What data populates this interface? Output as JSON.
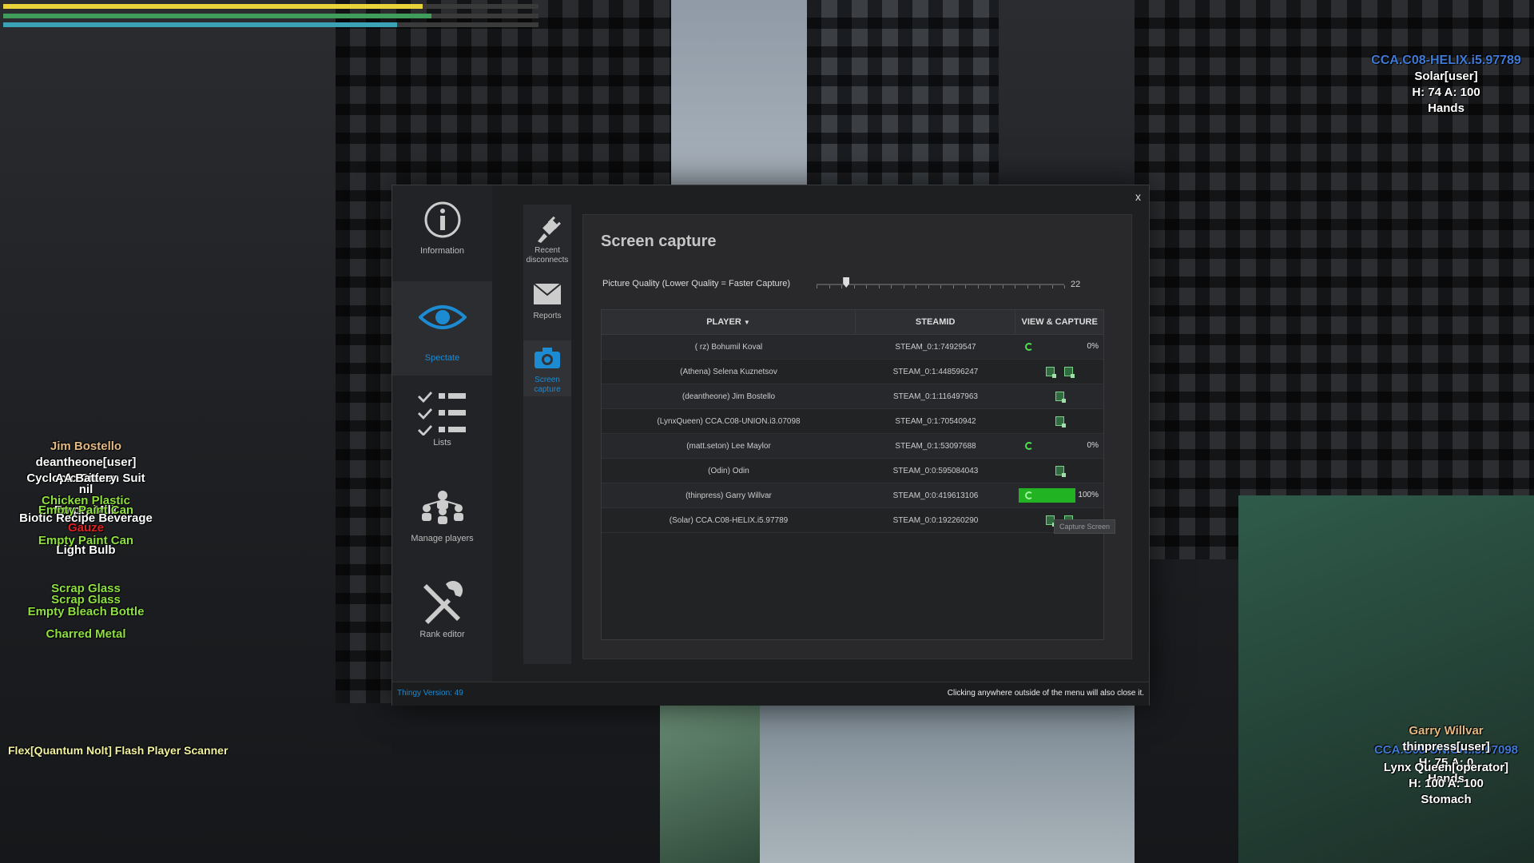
{
  "hud": {
    "health_fraction": 0.98,
    "armor_fraction": 1.0,
    "stamina_fraction": 0.92,
    "colors": {
      "health": "#e8d43a",
      "armor": "#3f9c5a",
      "stamina": "#3aa3b5"
    }
  },
  "world_labels": {
    "left": [
      "Jim Bostello",
      "deantheone[user]",
      "Cyclopic Citizen Suit",
      "AA Battery",
      "nil",
      "Chicken Plastic",
      "Empty Milk",
      "Empty Paint Can",
      "Biotic Recipe Beverage",
      "Gauze",
      "Empty Paint Can",
      "Light Bulb",
      "Scrap Glass",
      "Scrap Glass",
      "Empty Bleach Bottle",
      "Charred Metal"
    ],
    "left_bottom": "Flex[Quantum Nolt] Flash Player Scanner",
    "top_right": {
      "name": "CCA.C08-HELIX.i5.97789",
      "user": "Solar[user]",
      "stats": "H: 74 A: 100",
      "weapon": "Hands"
    },
    "bottom_right": {
      "name": "Garry Willvar",
      "tag": "CCA.C08-UNION.i3.07098",
      "role": "thinpress[user]",
      "stats": "H: 75 A: 0",
      "user2": "Lynx Queen[operator]",
      "weapon": "Hands",
      "stats2": "H: 100 A: 100",
      "item": "Stomach"
    }
  },
  "menu": {
    "close_label": "x",
    "sidebar": [
      {
        "label": "Information",
        "icon": "info-icon"
      },
      {
        "label": "Spectate",
        "icon": "eye-icon"
      },
      {
        "label": "Lists",
        "icon": "list-icon"
      },
      {
        "label": "Manage players",
        "icon": "group-icon"
      },
      {
        "label": "Rank editor",
        "icon": "tools-icon"
      }
    ],
    "subnav": [
      {
        "label": "Recent disconnects",
        "icon": "plug-icon"
      },
      {
        "label": "Reports",
        "icon": "envelope-icon"
      },
      {
        "label": "Screen capture",
        "icon": "camera-icon"
      }
    ],
    "panel": {
      "title": "Screen capture",
      "quality_label": "Picture Quality (Lower Quality = Faster Capture)",
      "quality_value": "22",
      "quality_fraction": 0.12,
      "columns": [
        "PLAYER",
        "STEAMID",
        "VIEW & CAPTURE"
      ],
      "rows": [
        {
          "player": "( rz) Bohumil Koval",
          "steamid": "STEAM_0:1:74929547",
          "state": "progress",
          "progress": "0%"
        },
        {
          "player": "(Athena) Selena Kuznetsov",
          "steamid": "STEAM_0:1:448596247",
          "state": "two"
        },
        {
          "player": "(deantheone) Jim Bostello",
          "steamid": "STEAM_0:1:116497963",
          "state": "one"
        },
        {
          "player": "(LynxQueen) CCA.C08-UNION.i3.07098",
          "steamid": "STEAM_0:1:70540942",
          "state": "one"
        },
        {
          "player": "(matt.seton) Lee Maylor",
          "steamid": "STEAM_0:1:53097688",
          "state": "progress",
          "progress": "0%"
        },
        {
          "player": "(Odin) Odin",
          "steamid": "STEAM_0:0:595084043",
          "state": "one"
        },
        {
          "player": "(thinpress) Garry Willvar",
          "steamid": "STEAM_0:0:419613106",
          "state": "done",
          "progress": "100%"
        },
        {
          "player": "(Solar) CCA.C08-HELIX.i5.97789",
          "steamid": "STEAM_0:0:192260290",
          "state": "two"
        }
      ],
      "tooltip": "Capture Screen"
    },
    "footer": {
      "version": "Thingy Version: 49",
      "hint": "Clicking anywhere outside of the menu will also close it."
    }
  }
}
